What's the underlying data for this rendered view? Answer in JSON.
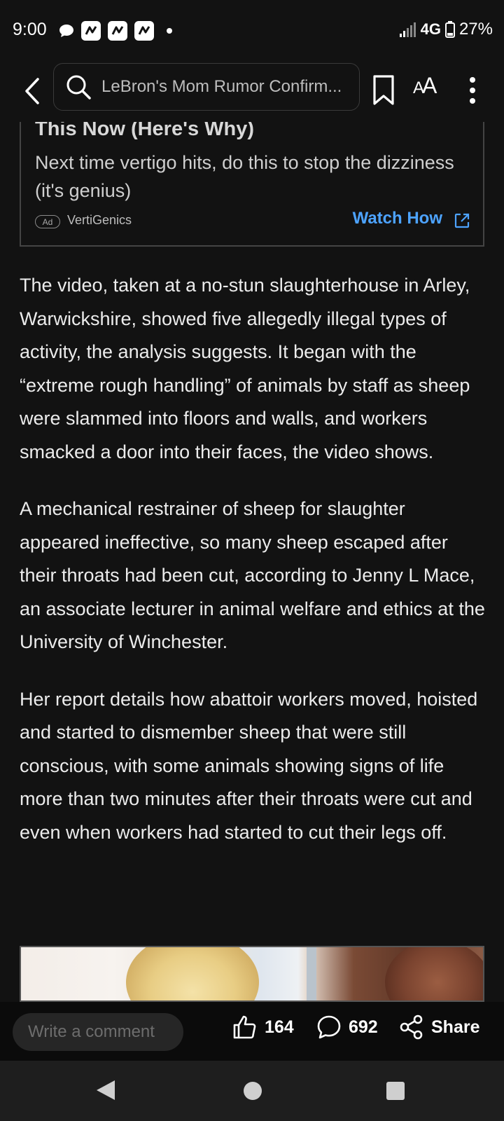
{
  "status_bar": {
    "time": "9:00",
    "network": "4G",
    "battery": "27%",
    "notification_icons": [
      "chat-bubble-icon",
      "app-notification-icon",
      "app-notification-icon",
      "app-notification-icon",
      "more-dot-icon"
    ]
  },
  "top_bar": {
    "search_text": "LeBron's Mom Rumor Confirm...",
    "icons": [
      "back-chevron-icon",
      "search-icon",
      "bookmark-icon",
      "text-size-icon",
      "more-vert-icon"
    ],
    "text_size_label": "AA"
  },
  "ad": {
    "title_fragment": "This Now (Here's Why)",
    "description": "Next time vertigo hits, do this to stop the dizziness (it's genius)",
    "badge": "Ad",
    "advertiser": "VertiGenics",
    "cta": "Watch How",
    "cta_color": "#4da3ff"
  },
  "article": {
    "paragraphs": [
      "The video, taken at a no-stun slaughterhouse in Arley, Warwickshire, showed five allegedly illegal types of activity, the analysis suggests. It began with the “extreme rough handling” of animals by staff as sheep were slammed into floors and walls, and workers smacked a door into their faces, the video shows.",
      "A mechanical restrainer of sheep for slaughter appeared ineffective, so many sheep escaped after their throats had been cut, according to Jenny L Mace, an associate lecturer in animal welfare and ethics at the University of Winchester.",
      "Her report details how abattoir workers moved, hoisted and started to dismember sheep that were still conscious, with some animals showing signs of life more than two minutes after their throats were cut and even when workers had started to cut their legs off."
    ]
  },
  "action_bar": {
    "comment_placeholder": "Write a comment",
    "likes": "164",
    "comments": "692",
    "share_label": "Share"
  },
  "nav_bar": {
    "icons": [
      "nav-back-icon",
      "nav-home-icon",
      "nav-recents-icon"
    ]
  }
}
